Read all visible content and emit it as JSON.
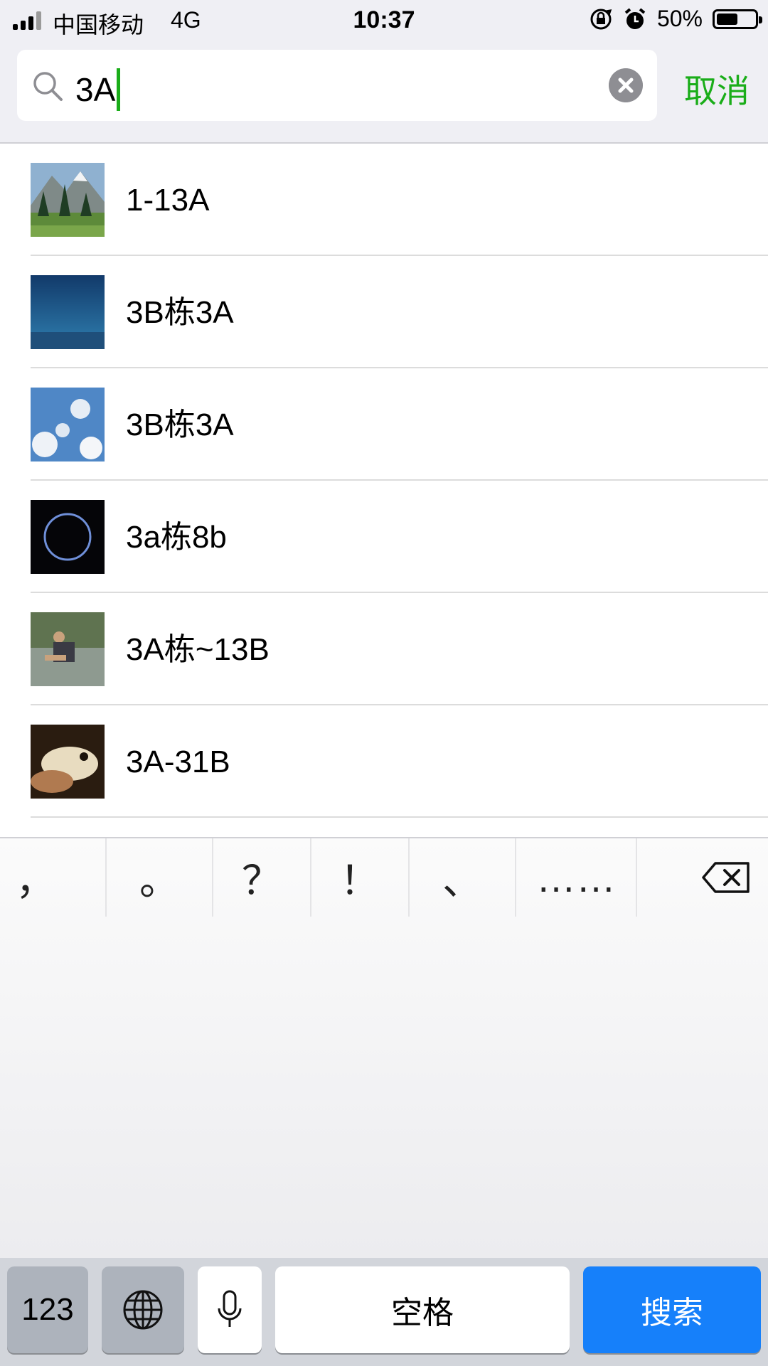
{
  "status_bar": {
    "carrier": "中国移动",
    "network": "4G",
    "time": "10:37",
    "battery_percent": "50%",
    "battery_level": 0.5,
    "icons": [
      "signal-icon",
      "rotation-lock-icon",
      "alarm-icon",
      "battery-icon"
    ]
  },
  "search": {
    "query": "3A",
    "cancel_label": "取消",
    "accent_color": "#1aad19"
  },
  "results": [
    {
      "title": "1-13A",
      "avatar": "mountain-landscape"
    },
    {
      "title": "3B栋3A",
      "avatar": "night-sky"
    },
    {
      "title": "3B栋3A",
      "avatar": "blue-sky-clouds"
    },
    {
      "title": "3a栋8b",
      "avatar": "dark-ring"
    },
    {
      "title": "3A栋~13B",
      "avatar": "person-by-water"
    },
    {
      "title": "3A-31B",
      "avatar": "dog-photo"
    }
  ],
  "keyboard": {
    "punctuation": [
      "，",
      "。",
      "？",
      "！",
      "、",
      "……"
    ],
    "numbers_key": "123",
    "space_key": "空格",
    "search_key": "搜索",
    "search_key_color": "#1680fa"
  }
}
